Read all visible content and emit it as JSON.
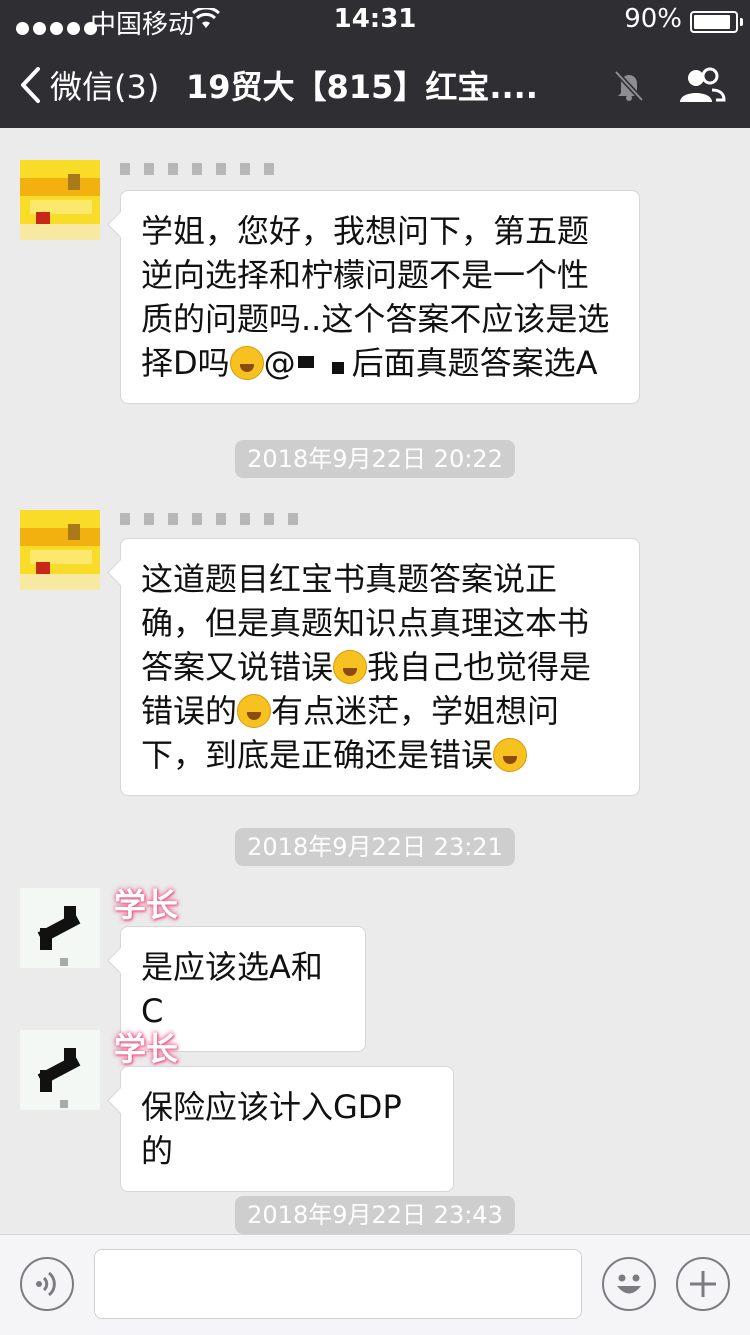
{
  "status_bar": {
    "carrier": "中国移动",
    "time": "14:31",
    "battery": "90%"
  },
  "nav": {
    "back_label": "微信(3)",
    "title": "19贸大【815】红宝...."
  },
  "messages": [
    {
      "text_1": "学姐，您好，我想问下，第五题逆向选择和柠檬问题不是一个性质的问题吗..这个答案不应该是选择D吗",
      "at": "@",
      "text_2": "后面真题答案选A"
    },
    {
      "text_1": "这道题目红宝书真题答案说正确，但是真题知识点真理这本书答案又说错误",
      "text_2": "我自己也觉得是错误的",
      "text_3": "有点迷茫，学姐想问下，到底是正确还是错误"
    },
    {
      "sender": "学长",
      "text": "是应该选A和C"
    },
    {
      "sender": "学长",
      "text": "保险应该计入GDP的"
    }
  ],
  "timestamps": [
    "2018年9月22日 20:22",
    "2018年9月22日 23:21",
    "2018年9月22日 23:43"
  ],
  "icons": {
    "back": "chevron-left-icon",
    "mute": "mute-bell-icon",
    "members": "group-icon",
    "voice": "voice-icon",
    "emoji": "emoji-icon",
    "add": "plus-icon"
  }
}
